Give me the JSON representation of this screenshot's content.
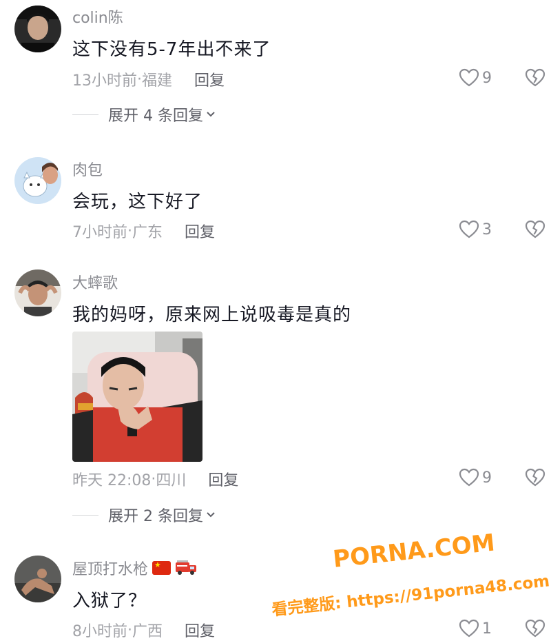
{
  "comments": [
    {
      "username": "colin陈",
      "text": "这下没有5-7年出不来了",
      "time": "13小时前",
      "location": "福建",
      "reply_label": "回复",
      "likes": "9",
      "expand_label": "展开 4 条回复"
    },
    {
      "username": "肉包",
      "text": "会玩，这下好了",
      "time": "7小时前",
      "location": "广东",
      "reply_label": "回复",
      "likes": "3"
    },
    {
      "username": "大蟀歌",
      "text": "我的妈呀，原来网上说吸毒是真的",
      "time": "昨天 22:08",
      "location": "四川",
      "reply_label": "回复",
      "likes": "9",
      "expand_label": "展开 2 条回复"
    },
    {
      "username": "屋顶打水枪",
      "username_emojis": [
        "china-flag-icon",
        "fire-truck-icon"
      ],
      "text": "入狱了？",
      "time": "8小时前",
      "location": "广西",
      "reply_label": "回复",
      "likes": "1"
    }
  ],
  "meta_separator": " · ",
  "watermark": {
    "line1": "PORNA.COM",
    "line2": "看完整版: https://91porna48.com"
  },
  "colors": {
    "username": "#8a8b91",
    "text": "#161823",
    "meta": "#a2a3a8",
    "watermark_fill": "#ff9a1a",
    "watermark_stroke": "#ffffff"
  }
}
